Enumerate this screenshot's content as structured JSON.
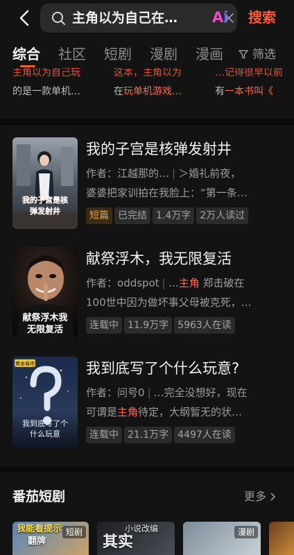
{
  "search": {
    "query": "主角以为自己在玩单机游戏",
    "ai_label_a": "A",
    "ai_label_i": "i",
    "submit_label": "搜索"
  },
  "tabs": [
    {
      "label": "综合",
      "active": true
    },
    {
      "label": "社区",
      "active": false
    },
    {
      "label": "短剧",
      "active": false
    },
    {
      "label": "漫剧",
      "active": false
    },
    {
      "label": "漫画",
      "active": false
    }
  ],
  "filter_label": "筛选",
  "prev_results": [
    {
      "line1": "主角以为自己玩",
      "line2_pre": "的是一款单机…",
      "line2_hl": ""
    },
    {
      "line1": "这本，主角以为",
      "line2_pre": "在",
      "line2_hl": "玩单机游戏…"
    },
    {
      "line1": "…记得很早以前",
      "line2_pre": "有",
      "line2_hl": "一本书叫《"
    }
  ],
  "books": [
    {
      "title": "我的子宫是核弹发射井",
      "author_label": "作者：",
      "author": "江越那的…",
      "desc_line1": "＞婚礼前夜，",
      "desc_line2": "婆婆把家训拍在我脸上：“第一条…",
      "tags": [
        "短篇",
        "已完结",
        "1.4万字",
        "2万人读过"
      ],
      "cover_text": "我的子宫是核弹发射井"
    },
    {
      "title": "献祭浮木，我无限复活",
      "author_label": "作者：",
      "author": "oddspot",
      "desc_pre": "…",
      "desc_hl": "主角",
      "desc_post": "郑击破在",
      "desc_line2": "100世中因为做坏事父母被克死，…",
      "tags": [
        "连载中",
        "11.9万字",
        "5963人在读"
      ],
      "cover_text_1": "献祭浮木我",
      "cover_text_2": "无限复活"
    },
    {
      "title": "我到底写了个什么玩意?",
      "author_label": "作者：",
      "author": "问号0",
      "desc_line1": "…完全没想好，现在",
      "desc_pre2": "可谓是",
      "desc_hl": "主角",
      "desc_post2": "待定，大纲暂无的状…",
      "tags": [
        "连载中",
        "21.1万字",
        "4497人在读"
      ],
      "cover_badge": "黄金看吧",
      "cover_text": "我到底写了个什么玩意"
    }
  ],
  "drama": {
    "title": "番茄短剧",
    "more": "更多",
    "cards": [
      {
        "text": "我能看提示",
        "text2": "翻牌",
        "tag": "短剧"
      },
      {
        "text": "小说改编",
        "text2": "其实",
        "tag": ""
      },
      {
        "text": "",
        "text2": "",
        "tag": "漫剧"
      },
      {
        "text": "",
        "text2": "",
        "tag": ""
      }
    ]
  },
  "colors": {
    "accent": "#fb5a3b",
    "background": "#131313",
    "tag_hot": "#e7a23d"
  }
}
